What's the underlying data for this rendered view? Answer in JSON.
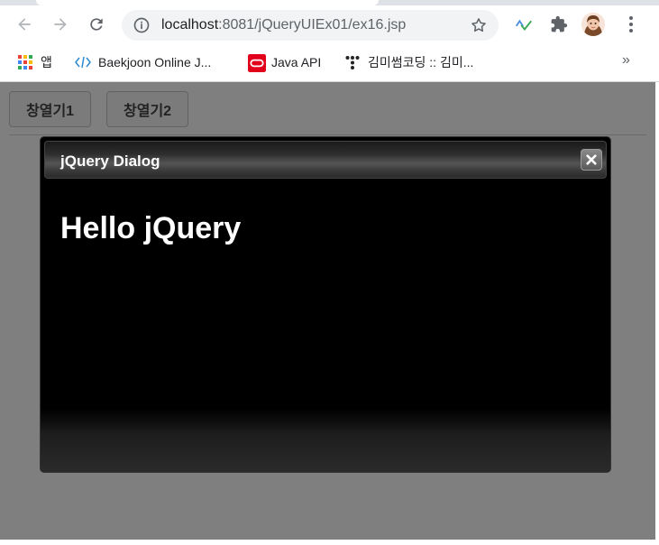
{
  "browser": {
    "url_host": "localhost",
    "url_path": ":8081/jQueryUIEx01/ex16.jsp",
    "bookmarks": [
      {
        "label": "앱",
        "icon": "apps-grid-icon"
      },
      {
        "label": "Baekjoon Online J...",
        "icon": "code-brackets-icon"
      },
      {
        "label": "Java API",
        "icon": "oracle-icon"
      },
      {
        "label": "김미썸코딩 :: 김미...",
        "icon": "tistory-icon"
      }
    ],
    "more_bookmarks": "»"
  },
  "page": {
    "buttons": [
      {
        "label": "창열기1"
      },
      {
        "label": "창열기2"
      }
    ]
  },
  "dialog": {
    "title": "jQuery Dialog",
    "content": "Hello jQuery"
  },
  "colors": {
    "overlay": "rgba(0,0,0,0.5)",
    "dialog_bg": "#000000",
    "title_text": "#ffffff"
  }
}
